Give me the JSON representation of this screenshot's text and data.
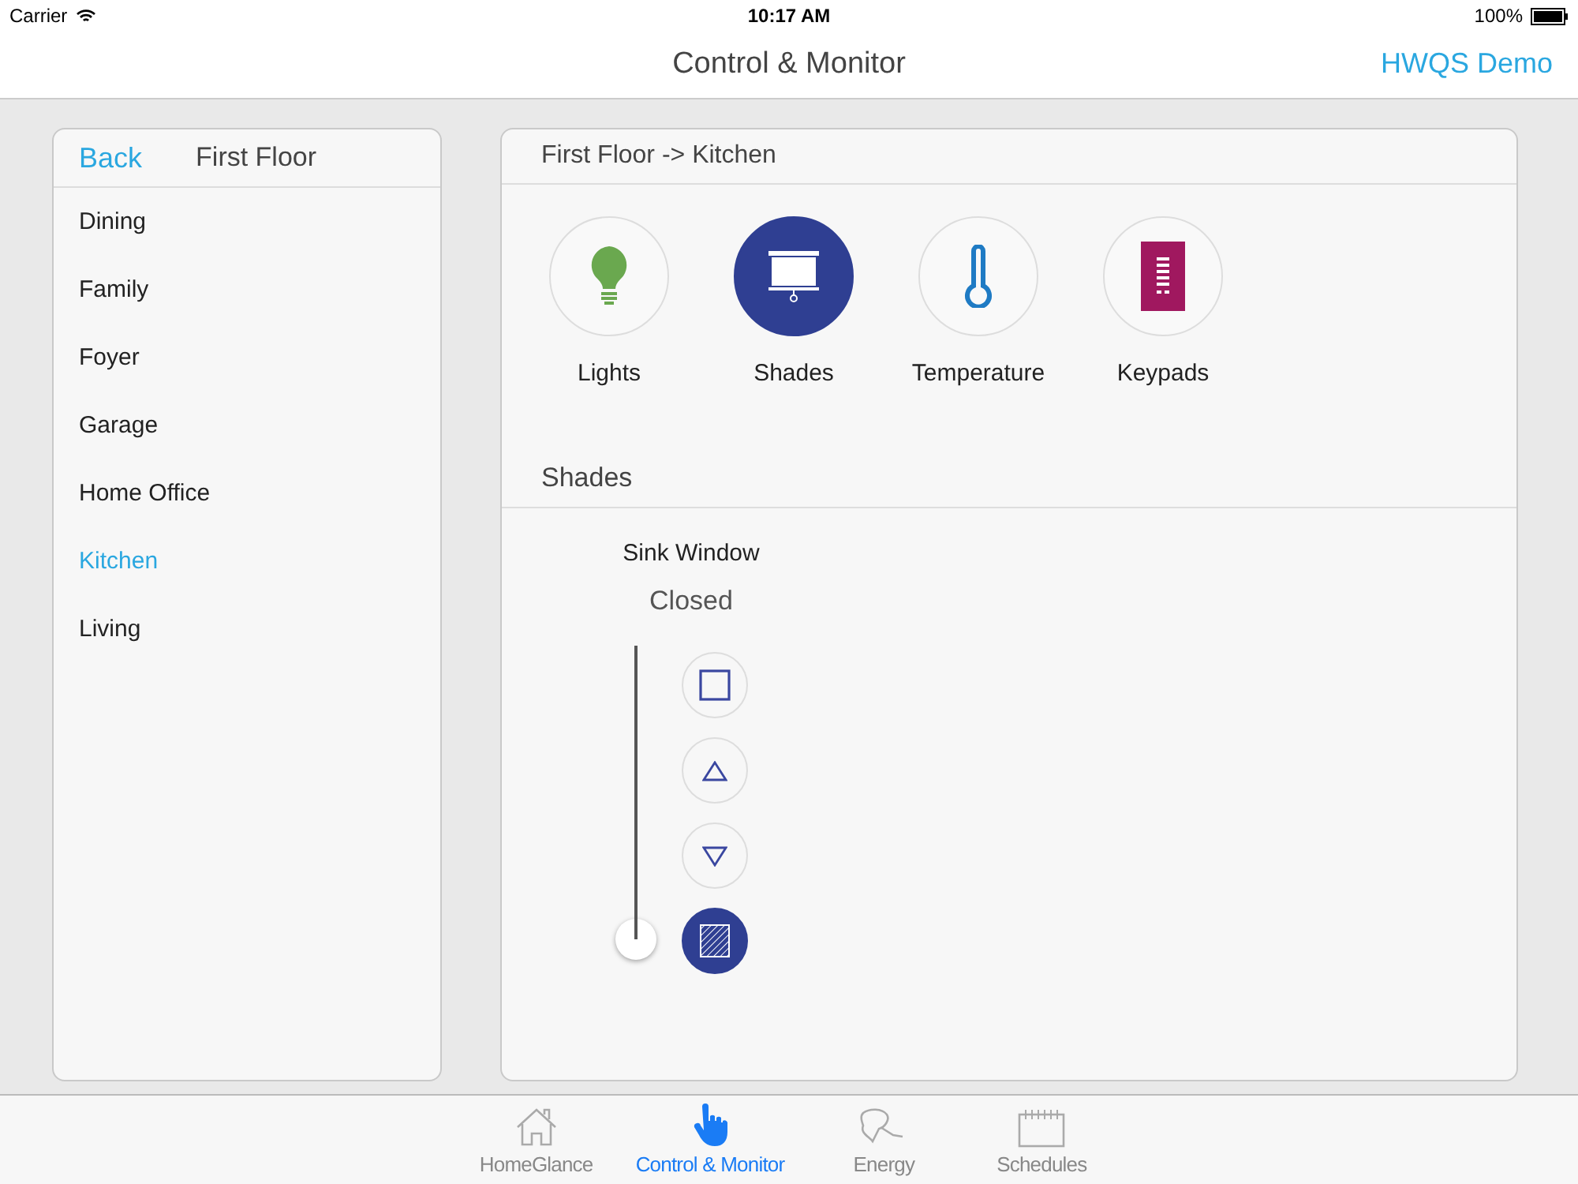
{
  "status_bar": {
    "carrier": "Carrier",
    "time": "10:17 AM",
    "battery": "100%"
  },
  "nav_bar": {
    "title": "Control & Monitor",
    "right_button": "HWQS Demo"
  },
  "sidebar": {
    "back": "Back",
    "title": "First Floor",
    "items": [
      {
        "label": "Dining",
        "selected": false
      },
      {
        "label": "Family",
        "selected": false
      },
      {
        "label": "Foyer",
        "selected": false
      },
      {
        "label": "Garage",
        "selected": false
      },
      {
        "label": "Home Office",
        "selected": false
      },
      {
        "label": "Kitchen",
        "selected": true
      },
      {
        "label": "Living",
        "selected": false
      }
    ]
  },
  "main": {
    "breadcrumb": "First Floor -> Kitchen",
    "categories": [
      {
        "kind": "lights",
        "label": "Lights",
        "selected": false
      },
      {
        "kind": "shades",
        "label": "Shades",
        "selected": true
      },
      {
        "kind": "temperature",
        "label": "Temperature",
        "selected": false
      },
      {
        "kind": "keypads",
        "label": "Keypads",
        "selected": false
      }
    ],
    "section_title": "Shades",
    "shade": {
      "name": "Sink Window",
      "status": "Closed",
      "level": 0,
      "buttons": [
        {
          "kind": "stop",
          "selected": false
        },
        {
          "kind": "up",
          "selected": false
        },
        {
          "kind": "down",
          "selected": false
        },
        {
          "kind": "close",
          "selected": true
        }
      ]
    }
  },
  "tab_bar": [
    {
      "kind": "home",
      "label": "HomeGlance",
      "selected": false
    },
    {
      "kind": "hand",
      "label": "Control & Monitor",
      "selected": true
    },
    {
      "kind": "energy",
      "label": "Energy",
      "selected": false
    },
    {
      "kind": "calendar",
      "label": "Schedules",
      "selected": false
    }
  ]
}
